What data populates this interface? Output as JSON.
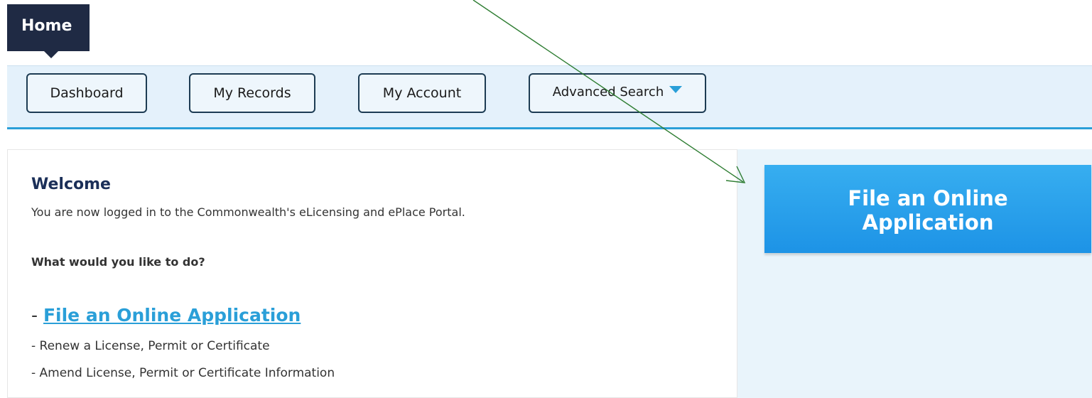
{
  "tabs": {
    "home_label": "Home"
  },
  "nav": {
    "dashboard": "Dashboard",
    "my_records": "My Records",
    "my_account": "My Account",
    "advanced_search": "Advanced Search"
  },
  "welcome": {
    "title": "Welcome",
    "message": "You are now logged in to the Commonwealth's eLicensing and ePlace Portal.",
    "question": "What would you like to do?",
    "link_prefix": "- ",
    "link_label": "File an Online Application",
    "options": [
      "- Renew a License, Permit or Certificate",
      "- Amend License, Permit or Certificate Information"
    ]
  },
  "sidebar": {
    "cta_line1": "File an Online",
    "cta_line2": "Application"
  },
  "colors": {
    "accent": "#2a9fd8",
    "header_dark": "#1f2a44",
    "annotation_arrow": "#2e7d32"
  }
}
